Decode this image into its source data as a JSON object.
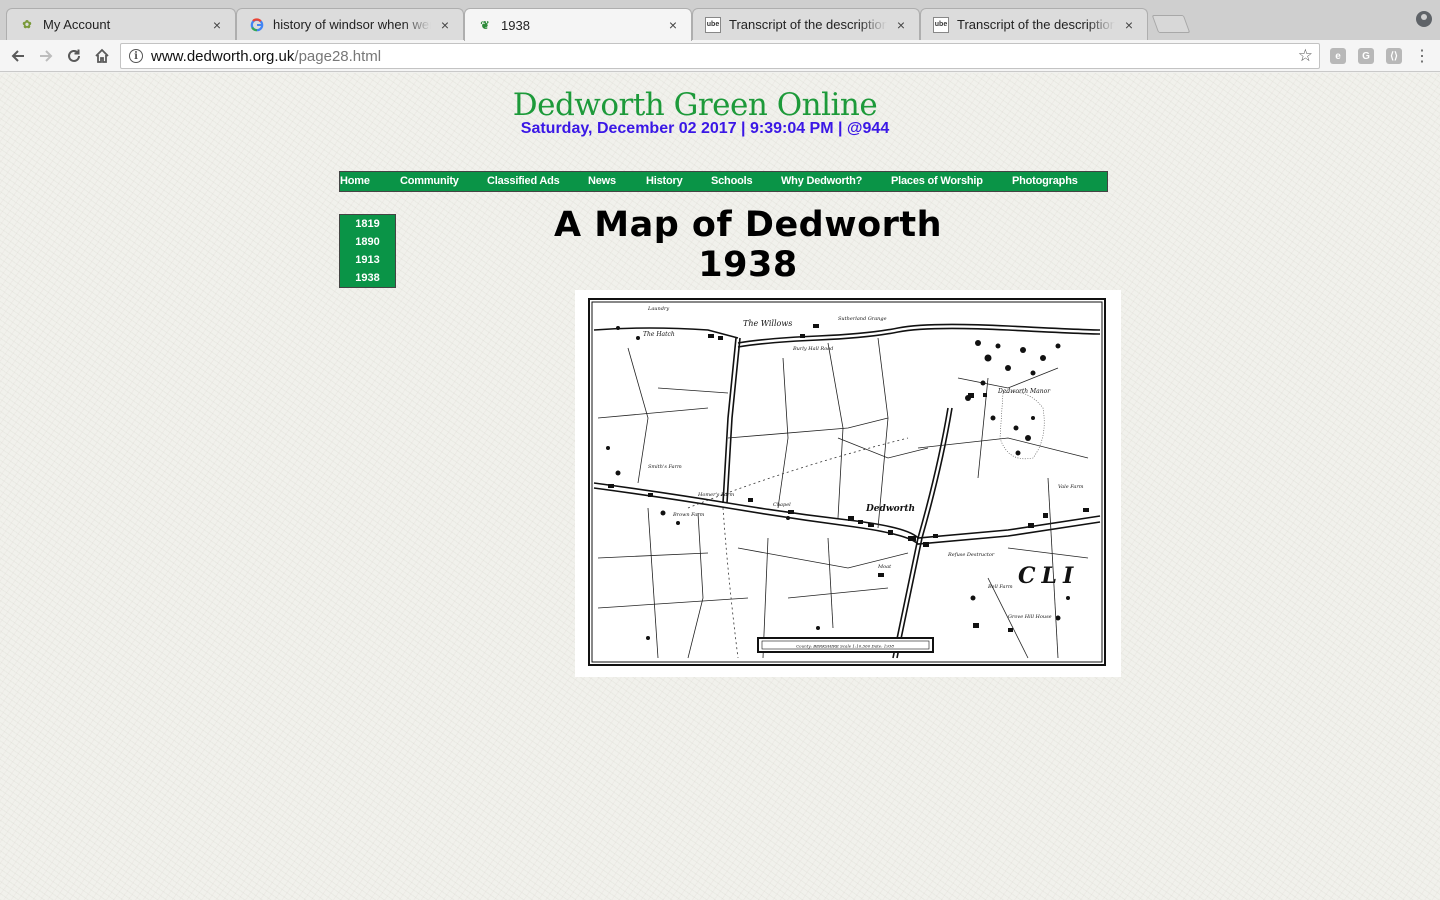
{
  "browser": {
    "tabs": [
      {
        "title": "My Account",
        "favicon": "leaf-favicon-icon",
        "active": false
      },
      {
        "title": "history of windsor when were",
        "favicon": "google-g-icon",
        "active": false
      },
      {
        "title": "1938",
        "favicon": "dedworth-favicon-icon",
        "active": true
      },
      {
        "title": "Transcript of the description f",
        "favicon": "ube-favicon-icon",
        "active": false
      },
      {
        "title": "Transcript of the description f",
        "favicon": "ube-favicon-icon",
        "active": false
      }
    ],
    "close_glyph": "×",
    "url_host": "www.dedworth.org.uk",
    "url_path": "/page28.html"
  },
  "site": {
    "title": "Dedworth Green Online",
    "datetime": "Saturday, December 02 2017 | 9:39:04 PM | @944"
  },
  "nav": [
    "Home",
    "Community",
    "Classified Ads",
    "News",
    "History",
    "Schools",
    "Why Dedworth?",
    "Places of Worship",
    "Photographs"
  ],
  "sidebar": [
    "1819",
    "1890",
    "1913",
    "1938"
  ],
  "heading": "A Map of Dedworth 1938",
  "map": {
    "labels": {
      "willows": "The Willows",
      "sutherland": "Sutherland Grange",
      "hatch": "The Hatch",
      "laundry": "Laundry",
      "burly_hall": "Burly Hall Road",
      "dedworth": "Dedworth",
      "dedworth_manor": "Dedworth Manor",
      "vale_farm": "Vale Farm",
      "homers": "Homer's Farm",
      "brown_farm": "Brown Farm",
      "smiths": "Smith's Farm",
      "bell_farm": "Bell Farm",
      "grove_hill": "Grove Hill House",
      "clewer": "CLI",
      "chapel": "Chapel",
      "refuse": "Refuse Destructor",
      "moat": "Moat",
      "scale_caption": "County: BERKSHIRE Scale 1:10,560 Date: 1938"
    },
    "colors": {
      "ink": "#111111",
      "paper": "#ffffff"
    }
  },
  "colors": {
    "title_green": "#1d9a3a",
    "datetime_blue": "#3a17e6",
    "nav_green": "#0a9447"
  }
}
